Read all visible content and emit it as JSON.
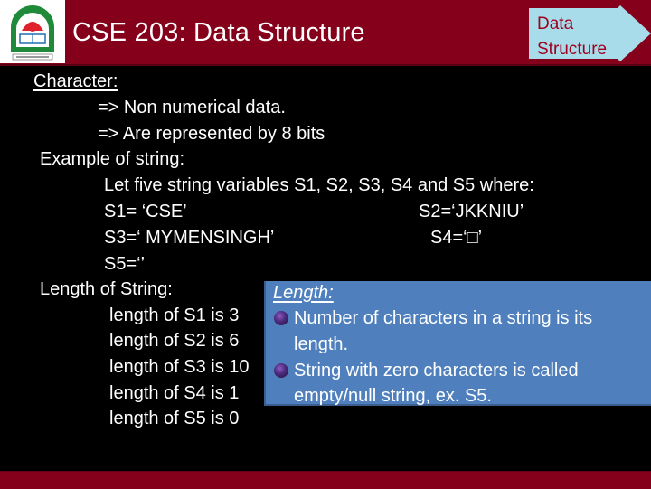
{
  "header": {
    "title": "CSE 203: Data Structure",
    "logo": "university-logo",
    "callout": {
      "line1": "Data",
      "line2": "Structure"
    }
  },
  "body": {
    "character_heading": "Character:",
    "character_points": [
      "=> Non numerical data.",
      "=> Are represented by 8 bits"
    ],
    "example_heading": "Example of string:",
    "example_intro": "Let five string variables S1, S2, S3, S4 and S5 where:",
    "assignments": {
      "s1": "S1= ‘CSE’",
      "s2": "S2=‘JKKNIU’",
      "s3": "S3=‘ MYMENSINGH’",
      "s4": "S4=‘□’",
      "s5": "S5=‘’"
    },
    "length_heading": "Length of String:",
    "lengths": [
      "length of S1 is 3",
      "length of S2 is 6",
      "length of S3 is 10",
      "length of S4 is 1",
      "length of S5 is 0"
    ]
  },
  "definition_box": {
    "heading": "Length:",
    "bullets": [
      {
        "line1": "Number of characters in a string is its",
        "line2": "length."
      },
      {
        "line1": "String with zero characters is called",
        "line2": "empty/null string, ex. S5."
      }
    ]
  },
  "colors": {
    "header_bg": "#85001a",
    "callout_bg": "#a8dcea",
    "callout_text": "#a0001e",
    "box_bg": "#4f80bd",
    "body_bg": "#000000"
  }
}
